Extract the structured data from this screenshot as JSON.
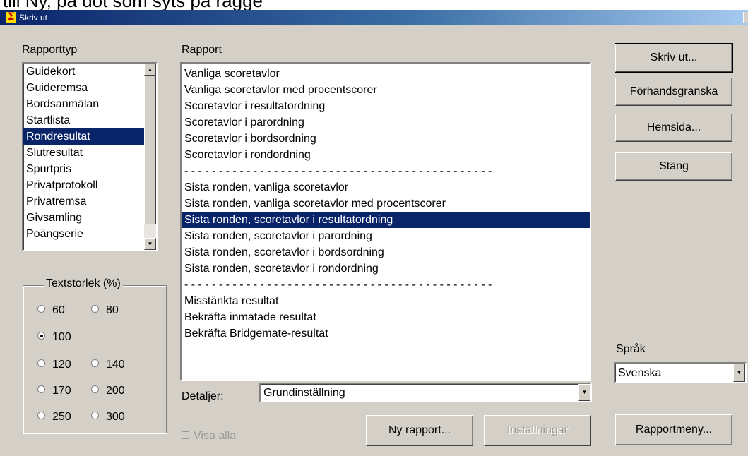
{
  "top_strip_text": "till Ny, på dot som  syts på rägge",
  "window": {
    "title": "Skriv ut",
    "icon": "sigma-icon"
  },
  "rapporttyp": {
    "label": "Rapporttyp",
    "items": [
      "Guidekort",
      "Guideremsa",
      "Bordsanmälan",
      "Startlista",
      "Rondresultat",
      "Slutresultat",
      "Spurtpris",
      "Privatprotokoll",
      "Privatremsa",
      "Givsamling",
      "Poängserie"
    ],
    "selected": "Rondresultat"
  },
  "rapport": {
    "label": "Rapport",
    "items": [
      "Vanliga scoretavlor",
      "Vanliga scoretavlor med procentscorer",
      "Scoretavlor i resultatordning",
      "Scoretavlor i parordning",
      "Scoretavlor i bordsordning",
      "Scoretavlor i rondordning",
      "- - - - - - - - - - - - - - - - - - - - - - - - - - - - - - - - - - - - - - - - - - - - -",
      "Sista ronden, vanliga scoretavlor",
      "Sista ronden, vanliga scoretavlor med procentscorer",
      "Sista ronden, scoretavlor i resultatordning",
      "Sista ronden, scoretavlor i parordning",
      "Sista ronden, scoretavlor i bordsordning",
      "Sista ronden, scoretavlor i rondordning",
      "- - - - - - - - - - - - - - - - - - - - - - - - - - - - - - - - - - - - - - - - - - - - -",
      "Misstänkta resultat",
      "Bekräfta inmatade resultat",
      "Bekräfta Bridgemate-resultat"
    ],
    "selected": "Sista ronden, scoretavlor i resultatordning"
  },
  "textstorlek": {
    "label": "Textstorlek (%)",
    "options": [
      "60",
      "80",
      "100",
      "120",
      "140",
      "170",
      "200",
      "250",
      "300"
    ],
    "selected": "100"
  },
  "detaljer": {
    "label": "Detaljer:",
    "value": "Grundinställning"
  },
  "visa_alla": {
    "label": "Visa alla",
    "checked": false,
    "enabled": false
  },
  "buttons": {
    "skriv_ut": "Skriv ut...",
    "forhandsgranska": "Förhandsgranska",
    "hemsida": "Hemsida...",
    "stang": "Stäng",
    "ny_rapport": "Ny rapport...",
    "installningar": "Inställningar",
    "rapportmeny": "Rapportmeny..."
  },
  "sprak": {
    "label": "Språk",
    "value": "Svenska"
  },
  "colors": {
    "selection": "#0a246a",
    "face": "#d4d0c8",
    "title_start": "#0a246a",
    "title_end": "#a6caf0"
  }
}
